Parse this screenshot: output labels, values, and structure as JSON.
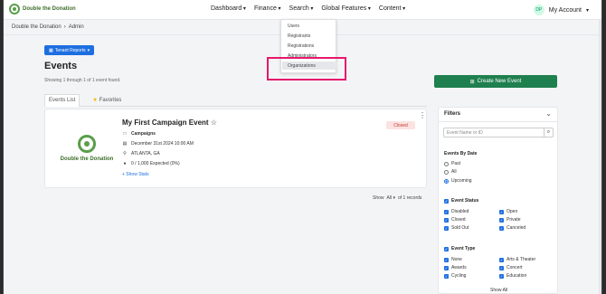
{
  "nav": {
    "logo_text": "Double the Donation",
    "menu": [
      "Dashboard",
      "Finance",
      "Search",
      "Global Features",
      "Content"
    ],
    "account_initials": "DP",
    "account_label": "My Account"
  },
  "breadcrumb": [
    "Double the Donation",
    "Admin"
  ],
  "search_menu": {
    "items": [
      "Users",
      "Registrants",
      "Registrations",
      "Administrators",
      "Organizations"
    ],
    "highlighted": "Organizations"
  },
  "page": {
    "tenant_button": "Tenant Reports",
    "title": "Events",
    "showing": "Showing 1 through 1 of 1 event found.",
    "create_button": "Create New Event"
  },
  "tabs": [
    "Events List",
    "Favorites"
  ],
  "event": {
    "logo_text": "Double the Donation",
    "title": "My First Campaign Event",
    "type": "Campaigns",
    "date": "December 31st 2024 10:00 AM",
    "location": "ATLANTA, GA",
    "expected": "0 / 1,000 Expected (0%)",
    "show_stats": "+ Show Stats",
    "status": "Closed"
  },
  "pager": {
    "show_label": "Show",
    "show_value": "All",
    "of_records": "of 1 records"
  },
  "filters": {
    "title": "Filters",
    "search_placeholder": "Event Name or ID",
    "events_by_date": {
      "label": "Events By Date",
      "options": [
        "Past",
        "All",
        "Upcoming"
      ],
      "selected": "Upcoming"
    },
    "event_status": {
      "label": "Event Status",
      "options": [
        "Disabled",
        "Open",
        "Closed",
        "Private",
        "Sold Out",
        "Canceled"
      ]
    },
    "event_type": {
      "label": "Event Type",
      "options": [
        "None",
        "Arts & Theater",
        "Awards",
        "Concert",
        "Cycling",
        "Education"
      ]
    },
    "show_all": "Show All"
  },
  "colors": {
    "primary": "#1d6fe0",
    "create": "#1e7f4f",
    "closed_bg": "#fde2e2",
    "closed_text": "#c0392b",
    "highlight": "#e6196b"
  }
}
